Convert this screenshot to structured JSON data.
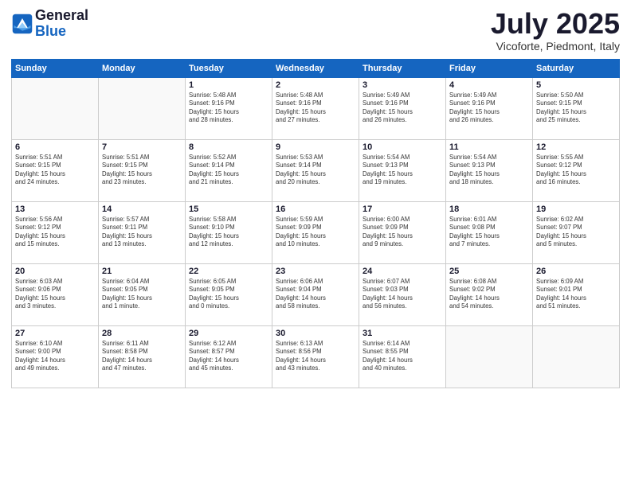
{
  "logo": {
    "general": "General",
    "blue": "Blue"
  },
  "header": {
    "month": "July 2025",
    "location": "Vicoforte, Piedmont, Italy"
  },
  "weekdays": [
    "Sunday",
    "Monday",
    "Tuesday",
    "Wednesday",
    "Thursday",
    "Friday",
    "Saturday"
  ],
  "weeks": [
    [
      {
        "day": "",
        "info": ""
      },
      {
        "day": "",
        "info": ""
      },
      {
        "day": "1",
        "info": "Sunrise: 5:48 AM\nSunset: 9:16 PM\nDaylight: 15 hours\nand 28 minutes."
      },
      {
        "day": "2",
        "info": "Sunrise: 5:48 AM\nSunset: 9:16 PM\nDaylight: 15 hours\nand 27 minutes."
      },
      {
        "day": "3",
        "info": "Sunrise: 5:49 AM\nSunset: 9:16 PM\nDaylight: 15 hours\nand 26 minutes."
      },
      {
        "day": "4",
        "info": "Sunrise: 5:49 AM\nSunset: 9:16 PM\nDaylight: 15 hours\nand 26 minutes."
      },
      {
        "day": "5",
        "info": "Sunrise: 5:50 AM\nSunset: 9:15 PM\nDaylight: 15 hours\nand 25 minutes."
      }
    ],
    [
      {
        "day": "6",
        "info": "Sunrise: 5:51 AM\nSunset: 9:15 PM\nDaylight: 15 hours\nand 24 minutes."
      },
      {
        "day": "7",
        "info": "Sunrise: 5:51 AM\nSunset: 9:15 PM\nDaylight: 15 hours\nand 23 minutes."
      },
      {
        "day": "8",
        "info": "Sunrise: 5:52 AM\nSunset: 9:14 PM\nDaylight: 15 hours\nand 21 minutes."
      },
      {
        "day": "9",
        "info": "Sunrise: 5:53 AM\nSunset: 9:14 PM\nDaylight: 15 hours\nand 20 minutes."
      },
      {
        "day": "10",
        "info": "Sunrise: 5:54 AM\nSunset: 9:13 PM\nDaylight: 15 hours\nand 19 minutes."
      },
      {
        "day": "11",
        "info": "Sunrise: 5:54 AM\nSunset: 9:13 PM\nDaylight: 15 hours\nand 18 minutes."
      },
      {
        "day": "12",
        "info": "Sunrise: 5:55 AM\nSunset: 9:12 PM\nDaylight: 15 hours\nand 16 minutes."
      }
    ],
    [
      {
        "day": "13",
        "info": "Sunrise: 5:56 AM\nSunset: 9:12 PM\nDaylight: 15 hours\nand 15 minutes."
      },
      {
        "day": "14",
        "info": "Sunrise: 5:57 AM\nSunset: 9:11 PM\nDaylight: 15 hours\nand 13 minutes."
      },
      {
        "day": "15",
        "info": "Sunrise: 5:58 AM\nSunset: 9:10 PM\nDaylight: 15 hours\nand 12 minutes."
      },
      {
        "day": "16",
        "info": "Sunrise: 5:59 AM\nSunset: 9:09 PM\nDaylight: 15 hours\nand 10 minutes."
      },
      {
        "day": "17",
        "info": "Sunrise: 6:00 AM\nSunset: 9:09 PM\nDaylight: 15 hours\nand 9 minutes."
      },
      {
        "day": "18",
        "info": "Sunrise: 6:01 AM\nSunset: 9:08 PM\nDaylight: 15 hours\nand 7 minutes."
      },
      {
        "day": "19",
        "info": "Sunrise: 6:02 AM\nSunset: 9:07 PM\nDaylight: 15 hours\nand 5 minutes."
      }
    ],
    [
      {
        "day": "20",
        "info": "Sunrise: 6:03 AM\nSunset: 9:06 PM\nDaylight: 15 hours\nand 3 minutes."
      },
      {
        "day": "21",
        "info": "Sunrise: 6:04 AM\nSunset: 9:05 PM\nDaylight: 15 hours\nand 1 minute."
      },
      {
        "day": "22",
        "info": "Sunrise: 6:05 AM\nSunset: 9:05 PM\nDaylight: 15 hours\nand 0 minutes."
      },
      {
        "day": "23",
        "info": "Sunrise: 6:06 AM\nSunset: 9:04 PM\nDaylight: 14 hours\nand 58 minutes."
      },
      {
        "day": "24",
        "info": "Sunrise: 6:07 AM\nSunset: 9:03 PM\nDaylight: 14 hours\nand 56 minutes."
      },
      {
        "day": "25",
        "info": "Sunrise: 6:08 AM\nSunset: 9:02 PM\nDaylight: 14 hours\nand 54 minutes."
      },
      {
        "day": "26",
        "info": "Sunrise: 6:09 AM\nSunset: 9:01 PM\nDaylight: 14 hours\nand 51 minutes."
      }
    ],
    [
      {
        "day": "27",
        "info": "Sunrise: 6:10 AM\nSunset: 9:00 PM\nDaylight: 14 hours\nand 49 minutes."
      },
      {
        "day": "28",
        "info": "Sunrise: 6:11 AM\nSunset: 8:58 PM\nDaylight: 14 hours\nand 47 minutes."
      },
      {
        "day": "29",
        "info": "Sunrise: 6:12 AM\nSunset: 8:57 PM\nDaylight: 14 hours\nand 45 minutes."
      },
      {
        "day": "30",
        "info": "Sunrise: 6:13 AM\nSunset: 8:56 PM\nDaylight: 14 hours\nand 43 minutes."
      },
      {
        "day": "31",
        "info": "Sunrise: 6:14 AM\nSunset: 8:55 PM\nDaylight: 14 hours\nand 40 minutes."
      },
      {
        "day": "",
        "info": ""
      },
      {
        "day": "",
        "info": ""
      }
    ]
  ]
}
